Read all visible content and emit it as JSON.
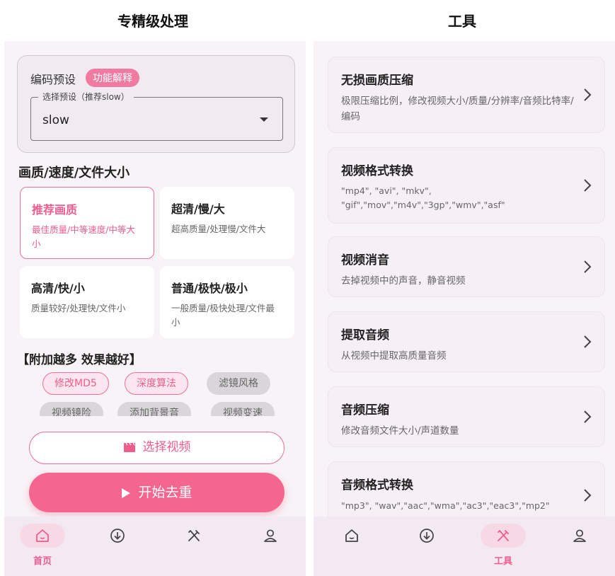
{
  "left": {
    "panel_title": "专精级处理",
    "preset": {
      "label": "编码预设",
      "explain_button": "功能解释",
      "select_legend": "选择预设（推荐slow）",
      "select_value": "slow"
    },
    "quality_section_title": "画质/速度/文件大小",
    "options": [
      {
        "title": "推荐画质",
        "desc": "最佳质量/中等速度/中等大小",
        "selected": true
      },
      {
        "title": "超清/慢/大",
        "desc": "超高质量/处理慢/文件大",
        "selected": false
      },
      {
        "title": "高清/快/小",
        "desc": "质量较好/处理快/文件小",
        "selected": false
      },
      {
        "title": "普通/极快/极小",
        "desc": "一般质量/极快处理/文件最小",
        "selected": false
      }
    ],
    "addon_title": "【附加越多 效果越好】",
    "chips": [
      {
        "label": "修改MD5",
        "selected": true
      },
      {
        "label": "深度算法",
        "selected": true
      },
      {
        "label": "滤镜风格",
        "selected": false
      },
      {
        "label": "视频镜险",
        "selected": false
      },
      {
        "label": "添加背景音",
        "selected": false
      },
      {
        "label": "视频变速",
        "selected": false
      }
    ],
    "select_video_button": "选择视频",
    "start_button": "开始去重",
    "nav": [
      {
        "icon": "home-icon",
        "label": "首页",
        "active": true
      },
      {
        "icon": "download-icon",
        "label": "",
        "active": false
      },
      {
        "icon": "tools-icon",
        "label": "",
        "active": false
      },
      {
        "icon": "profile-icon",
        "label": "",
        "active": false
      }
    ]
  },
  "right": {
    "panel_title": "工具",
    "tools": [
      {
        "title": "无损画质压缩",
        "desc": "极限压缩比例，修改视频大小/质量/分辨率/音频比特率/编码"
      },
      {
        "title": "视频格式转换",
        "desc": "\"mp4\", \"avi\", \"mkv\", \"gif\",\"mov\",\"m4v\",\"3gp\",\"wmv\",\"asf\""
      },
      {
        "title": "视频消音",
        "desc": "去掉视频中的声音，静音视频"
      },
      {
        "title": "提取音频",
        "desc": "从视频中提取高质量音频"
      },
      {
        "title": "音频压缩",
        "desc": "修改音频文件大小/声道数量"
      },
      {
        "title": "音频格式转换",
        "desc": "\"mp3\", \"wav\",\"aac\",\"wma\",\"ac3\",\"eac3\",\"mp2\""
      }
    ],
    "nav": [
      {
        "icon": "home-icon",
        "label": "",
        "active": false
      },
      {
        "icon": "download-icon",
        "label": "",
        "active": false
      },
      {
        "icon": "tools-icon",
        "label": "工具",
        "active": true
      },
      {
        "icon": "profile-icon",
        "label": "",
        "active": false
      }
    ]
  },
  "colors": {
    "accent": "#ee5d8c",
    "accent_button": "#f4668f",
    "nav_background": "#f3e9f3"
  }
}
